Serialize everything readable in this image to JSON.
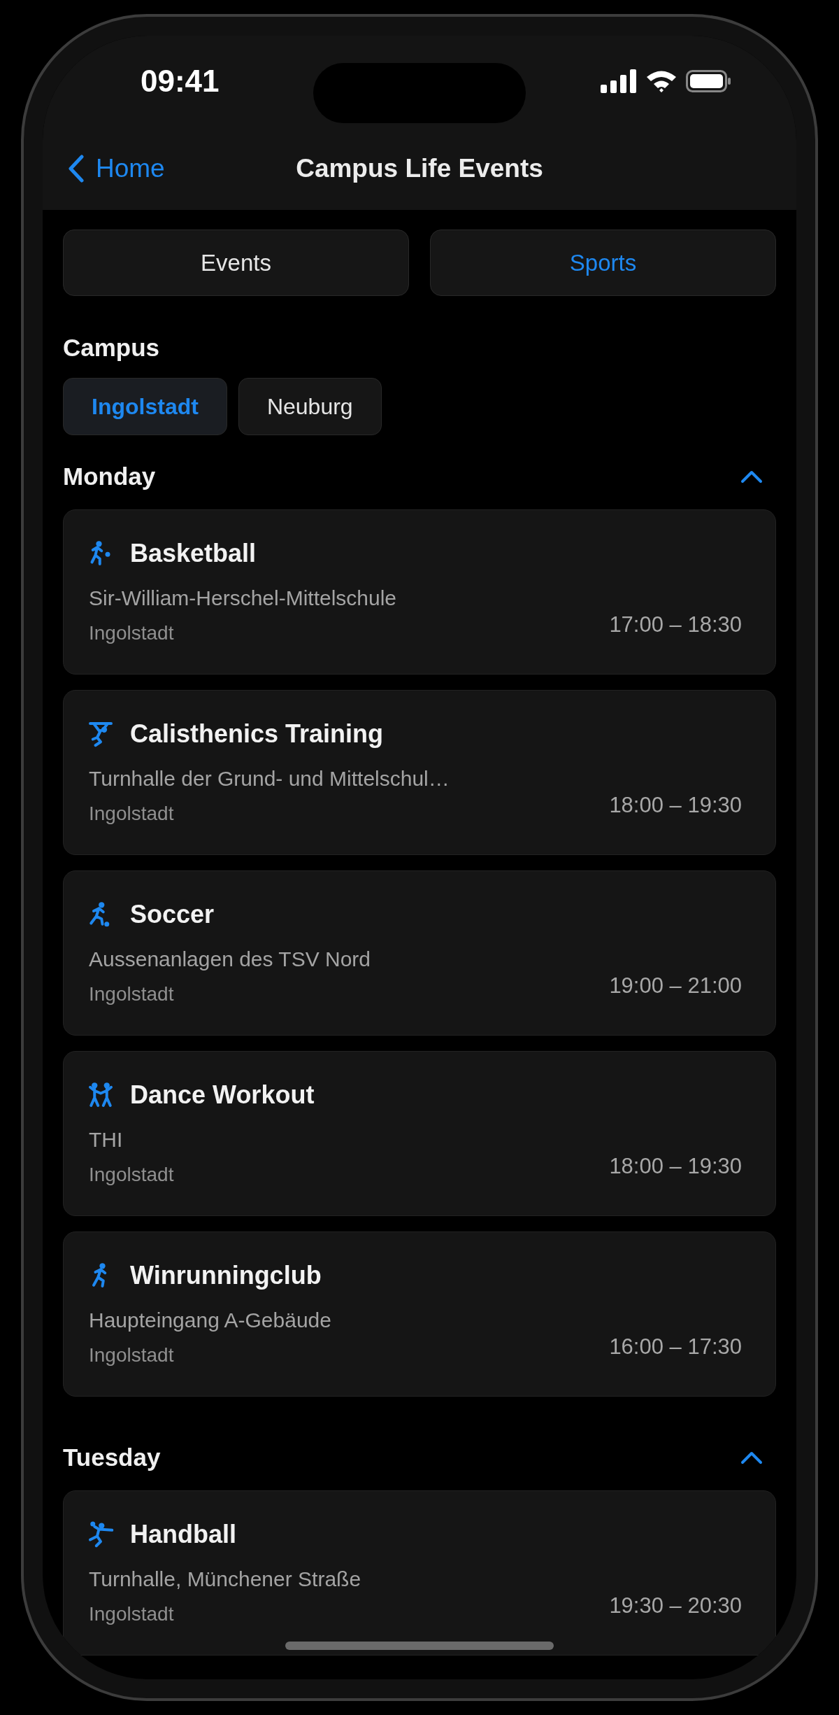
{
  "status_bar": {
    "time": "09:41"
  },
  "nav": {
    "back": "Home",
    "title": "Campus Life Events"
  },
  "tabs": [
    {
      "label": "Events",
      "selected": false
    },
    {
      "label": "Sports",
      "selected": true
    }
  ],
  "campus": {
    "label": "Campus",
    "options": [
      {
        "label": "Ingolstadt",
        "selected": true
      },
      {
        "label": "Neuburg",
        "selected": false
      }
    ]
  },
  "days": [
    {
      "name": "Monday",
      "expanded": true,
      "events": [
        {
          "kind": "basketball",
          "title": "Basketball",
          "venue": "Sir-William-Herschel-Mittelschule",
          "city": "Ingolstadt",
          "time": "17:00 – 18:30"
        },
        {
          "kind": "calisthenics",
          "title": "Calisthenics Training",
          "venue": "Turnhalle der Grund- und Mittelschul…",
          "city": "Ingolstadt",
          "time": "18:00 – 19:30"
        },
        {
          "kind": "soccer",
          "title": "Soccer",
          "venue": "Aussenanlagen des TSV Nord",
          "city": "Ingolstadt",
          "time": "19:00 – 21:00"
        },
        {
          "kind": "dance",
          "title": "Dance Workout",
          "venue": "THI",
          "city": "Ingolstadt",
          "time": "18:00 – 19:30"
        },
        {
          "kind": "running",
          "title": "Winrunningclub",
          "venue": "Haupteingang A-Gebäude",
          "city": "Ingolstadt",
          "time": "16:00 – 17:30"
        }
      ]
    },
    {
      "name": "Tuesday",
      "expanded": true,
      "events": [
        {
          "kind": "handball",
          "title": "Handball",
          "venue": "Turnhalle, Münchener Straße",
          "city": "Ingolstadt",
          "time": "19:30 – 20:30"
        }
      ]
    }
  ]
}
